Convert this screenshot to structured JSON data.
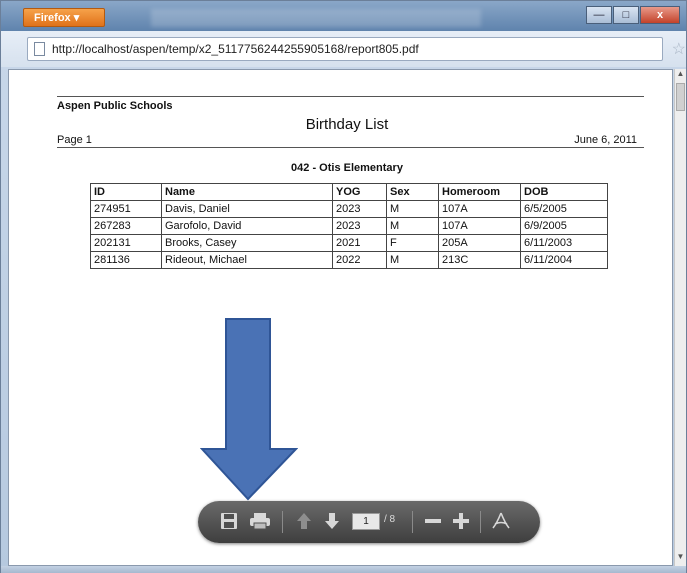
{
  "browser": {
    "app_button": "Firefox ▾",
    "caption": {
      "minimize": "—",
      "maximize": "□",
      "close": "x"
    },
    "url": "http://localhost/aspen/temp/x2_5117756244255905168/report805.pdf"
  },
  "report": {
    "school_district": "Aspen Public Schools",
    "title": "Birthday List",
    "page_label": "Page 1",
    "date": "June 6, 2011",
    "school": "042 - Otis Elementary",
    "columns": [
      "ID",
      "Name",
      "YOG",
      "Sex",
      "Homeroom",
      "DOB"
    ],
    "rows": [
      [
        "274951",
        "Davis, Daniel",
        "2023",
        "M",
        "107A",
        "6/5/2005"
      ],
      [
        "267283",
        "Garofolo, David",
        "2023",
        "M",
        "107A",
        "6/9/2005"
      ],
      [
        "202131",
        "Brooks, Casey",
        "2021",
        "F",
        "205A",
        "6/11/2003"
      ],
      [
        "281136",
        "Rideout, Michael",
        "2022",
        "M",
        "213C",
        "6/11/2004"
      ]
    ]
  },
  "pdf_toolbar": {
    "current_page": "1",
    "total_pages": "/ 8",
    "icons": [
      "save-icon",
      "print-icon",
      "page-up-icon",
      "page-down-icon",
      "zoom-out-icon",
      "zoom-in-icon",
      "acrobat-icon"
    ]
  },
  "annotation": {
    "arrow_color": "#4a72b5"
  }
}
